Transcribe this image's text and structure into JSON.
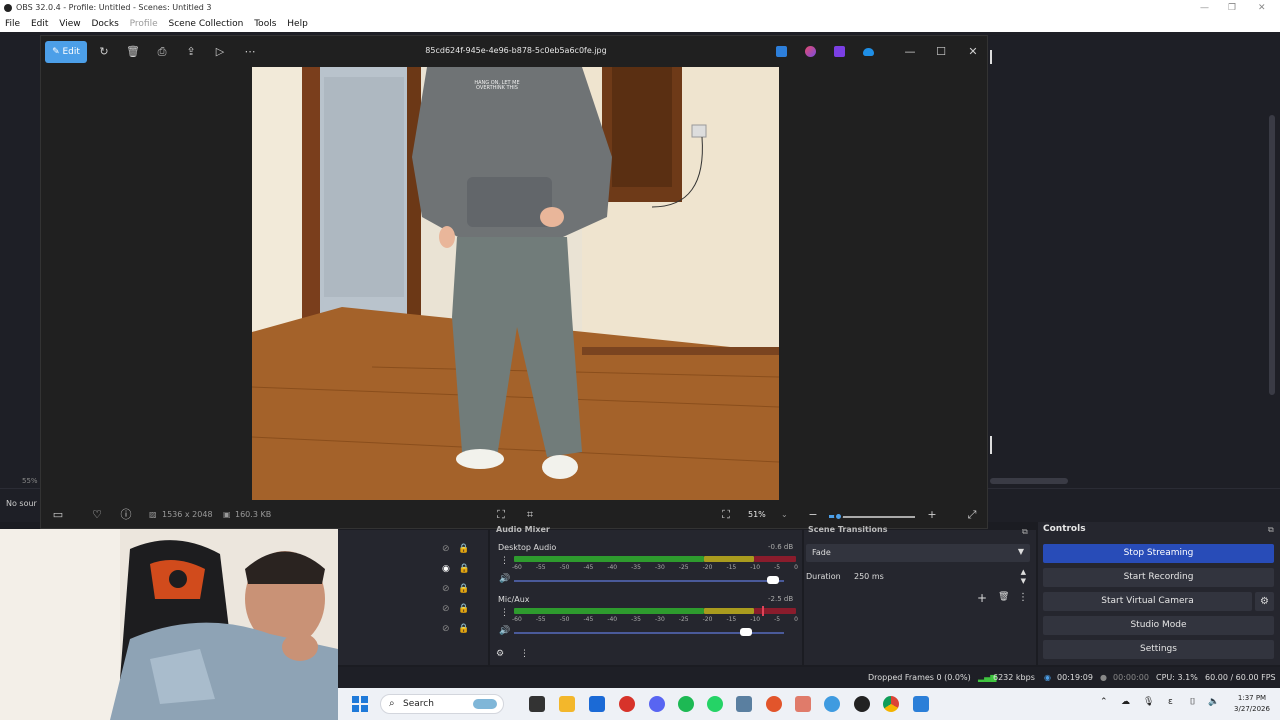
{
  "obs": {
    "window_title": "OBS 32.0.4 - Profile: Untitled - Scenes: Untitled 3",
    "menu": [
      "File",
      "Edit",
      "View",
      "Docks",
      "Profile",
      "Scene Collection",
      "Tools",
      "Help"
    ],
    "preview_zoom": "55%",
    "no_source_label": "No sour",
    "audio_mixer": {
      "title": "Audio Mixer",
      "channels": [
        {
          "name": "Desktop Audio",
          "db": "-0.6 dB",
          "volume": 0.96
        },
        {
          "name": "Mic/Aux",
          "db": "-2.5 dB",
          "volume": 0.86
        }
      ],
      "scale": [
        "-60",
        "-55",
        "-50",
        "-45",
        "-40",
        "-35",
        "-30",
        "-25",
        "-20",
        "-15",
        "-10",
        "-5",
        "0"
      ]
    },
    "transitions": {
      "title": "Scene Transitions",
      "selected": "Fade",
      "duration_label": "Duration",
      "duration_value": "250 ms"
    },
    "controls": {
      "title": "Controls",
      "buttons": [
        "Stop Streaming",
        "Start Recording",
        "Start Virtual Camera",
        "Studio Mode",
        "Settings"
      ]
    },
    "status": {
      "dropped_frames": "Dropped Frames 0 (0.0%)",
      "bitrate": "6232 kbps",
      "stream_time": "00:19:09",
      "record_time": "00:00:00",
      "cpu": "CPU: 3.1%",
      "fps": "60.00 / 60.00 FPS"
    }
  },
  "photos": {
    "edit_label": "Edit",
    "filename": "85cd624f-945e-4e96-b878-5c0eb5a6c0fe.jpg",
    "dimensions": "1536 x 2048",
    "file_size": "160.3 KB",
    "zoom": "51%",
    "zoom_level": 0.1,
    "hoodie_text": "HANG ON, LET ME OVERTHINK THIS"
  },
  "taskbar": {
    "search_placeholder": "Search",
    "time": "1:37 PM",
    "date": "3/27/2026"
  },
  "colors": {
    "accent_blue": "#284cb8",
    "photos_accent": "#4c9fe8",
    "obs_bg": "#1e1f26"
  }
}
